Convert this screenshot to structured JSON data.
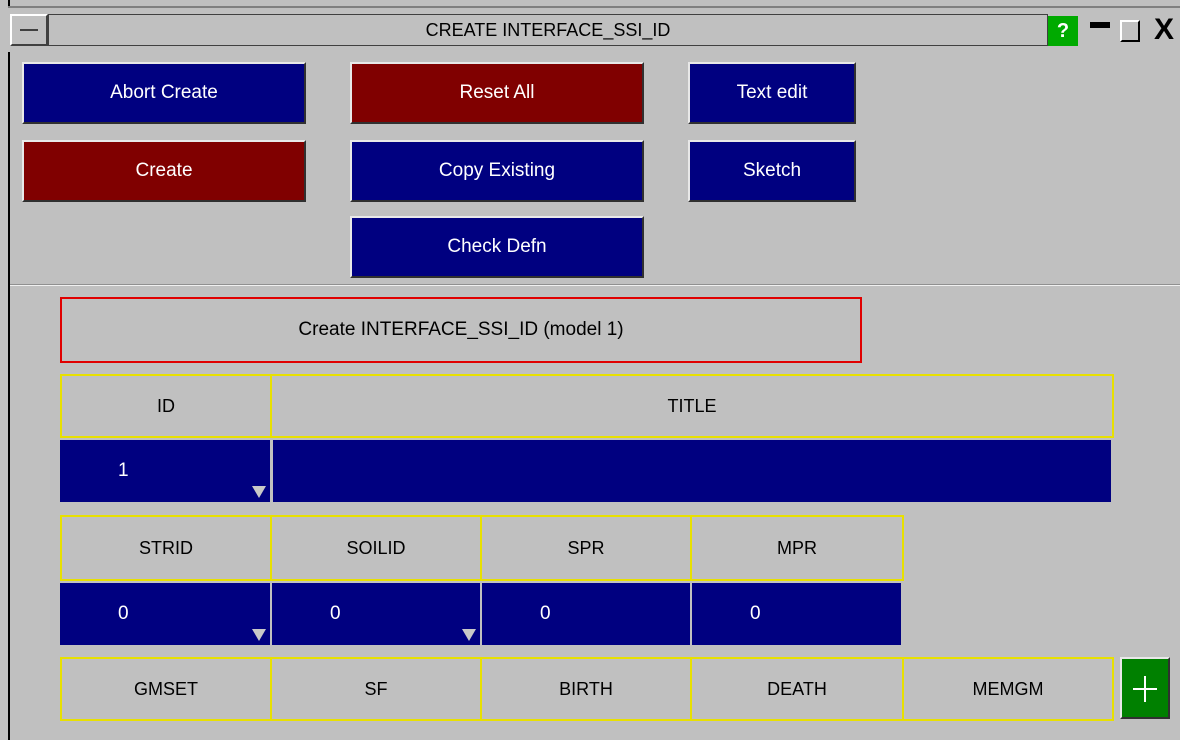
{
  "window": {
    "title": "CREATE INTERFACE_SSI_ID",
    "help_label": "?",
    "close_label": "X"
  },
  "toolbar": {
    "abort_create": "Abort Create",
    "create": "Create",
    "reset_all": "Reset All",
    "copy_existing": "Copy Existing",
    "check_defn": "Check Defn",
    "text_edit": "Text edit",
    "sketch": "Sketch"
  },
  "panel": {
    "title": "Create INTERFACE_SSI_ID (model 1)"
  },
  "card1": {
    "headers": [
      "ID",
      "TITLE"
    ],
    "values": [
      "1",
      ""
    ]
  },
  "card2": {
    "headers": [
      "STRID",
      "SOILID",
      "SPR",
      "MPR"
    ],
    "values": [
      "0",
      "0",
      "0",
      "0"
    ]
  },
  "card3": {
    "headers": [
      "GMSET",
      "SF",
      "BIRTH",
      "DEATH",
      "MEMGM"
    ]
  },
  "colors": {
    "background": "#c0c0c0",
    "button_blue": "#000080",
    "button_red": "#800000",
    "header_border": "#e8e000",
    "panel_border": "#e00000",
    "add_button": "#008000"
  }
}
